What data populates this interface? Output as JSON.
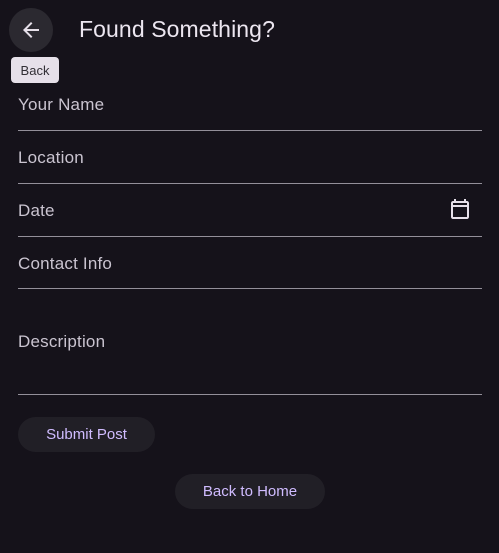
{
  "header": {
    "title": "Found Something?",
    "back_icon": "arrow-left-icon",
    "back_tooltip": "Back"
  },
  "form": {
    "name_label": "Your Name",
    "location_label": "Location",
    "date_label": "Date",
    "date_icon": "calendar-icon",
    "contact_label": "Contact Info",
    "description_label": "Description"
  },
  "actions": {
    "submit_label": "Submit Post",
    "home_label": "Back to Home"
  },
  "colors": {
    "background": "#15121a",
    "accent_text": "#d0bcff",
    "button_background": "#211f26",
    "divider": "#938f99"
  }
}
